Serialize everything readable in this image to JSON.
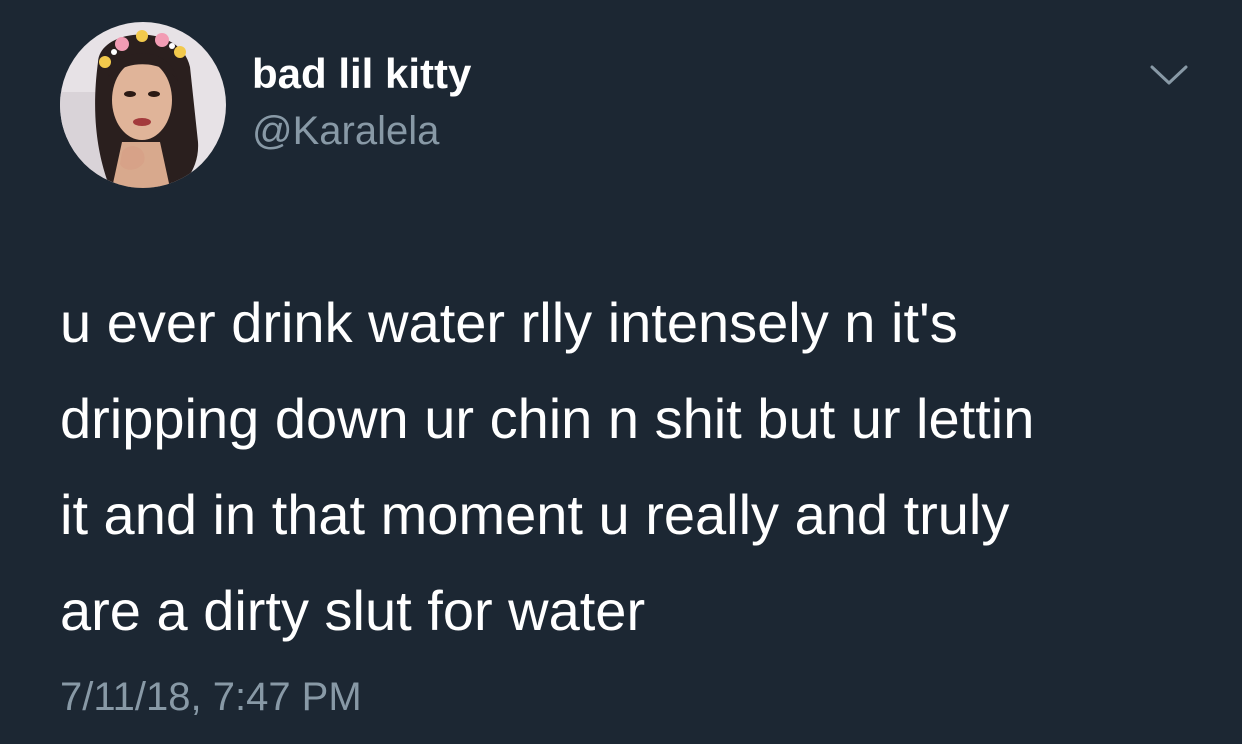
{
  "tweet": {
    "display_name": "bad lil kitty",
    "handle": "@Karalela",
    "text_lines": [
      "u ever drink water rlly intensely n it's",
      "dripping down ur chin n shit but ur lettin",
      "it and in that moment u really and truly",
      "are a dirty slut for water"
    ],
    "timestamp": "7/11/18, 7:47 PM",
    "menu_icon": "chevron-down-icon"
  },
  "colors": {
    "background": "#1c2733",
    "text_primary": "#ffffff",
    "text_secondary": "#8899a6"
  }
}
